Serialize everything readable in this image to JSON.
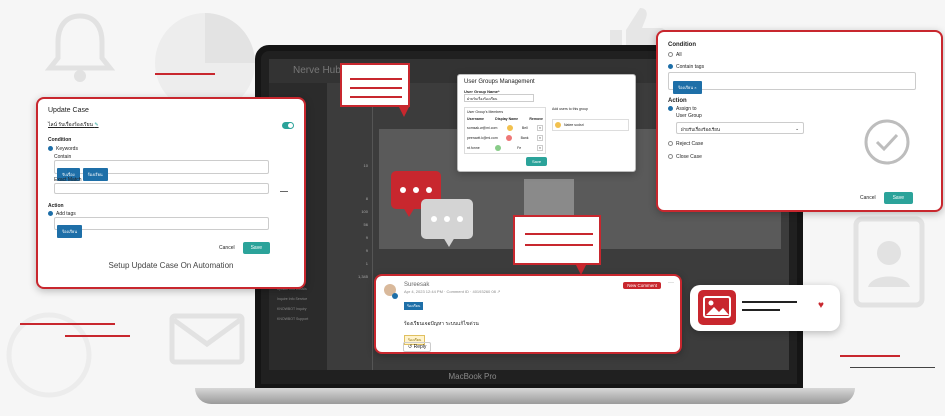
{
  "colors": {
    "accent": "#c8272e",
    "teal": "#2ba39a",
    "blue": "#1e6fa8"
  },
  "laptop": {
    "brand": "MacBook Pro",
    "header_faint": "Nerve Hub"
  },
  "update_case": {
    "title": "Update Case",
    "rule_name": "ไลน์ รับเรื่องร้องเรียน",
    "condition_label": "Condition",
    "keywords_label": "Keywords",
    "contain_label": "Contain",
    "contain_tags": [
      "รับเรื่อง",
      "ร้องเรียน"
    ],
    "exact_match_label": "Exact Match",
    "action_label": "Action",
    "add_tags_label": "Add tags",
    "action_tag": "ร้องเรียน",
    "cancel": "Cancel",
    "save": "Save",
    "caption": "Setup Update Case On Automation"
  },
  "user_group": {
    "title": "User Groups Management",
    "name_label": "User Group Name*",
    "name_value": "ฝ่ายรับเรื่องร้องเรียน",
    "members_label": "User Group's Members",
    "cols": [
      "Username",
      "Display Name",
      "Remove"
    ],
    "members": [
      {
        "username": "somsak.w@mi.com",
        "display": "Bell"
      },
      {
        "username": "peerawit.k@mi.com",
        "display": "Bank"
      },
      {
        "username": "nt.fonne",
        "display": "Fe"
      }
    ],
    "add_label": "Add users to this group",
    "add_user": "Natee sodsri",
    "save": "Save"
  },
  "condition_panel": {
    "condition_label": "Condition",
    "opt_all": "All",
    "opt_contain": "Contain tags",
    "contain_tag": "ร้องเรียน",
    "action_label": "Action",
    "opt_assign": "Assign to",
    "user_group_label": "User Group",
    "user_group_value": "ฝ่ายรับเรื่องร้องเรียน",
    "opt_reject": "Reject Case",
    "opt_close": "Close Case",
    "cancel": "Cancel",
    "save": "Save"
  },
  "comment": {
    "author": "Sureesak",
    "meta": "Apr 4, 2023 12:44 PM · Comment ID · 40193260 08",
    "tag": "ร้องเรียน",
    "badge": "New Comment",
    "text": "ร้องเรียนเจอปัญหา ระบบแก้ไขด่วน",
    "sub_tag": "ร้องเรียน",
    "reply": "Reply"
  },
  "sidebar_numbers": [
    "10",
    "8",
    "100",
    "56",
    "9",
    "9",
    "1",
    "1,345"
  ],
  "sidebar_items": [
    "Update Info Details",
    "Inquire Info Service",
    "KNOWBOT Inquiry",
    "KNOWBOT Support"
  ]
}
